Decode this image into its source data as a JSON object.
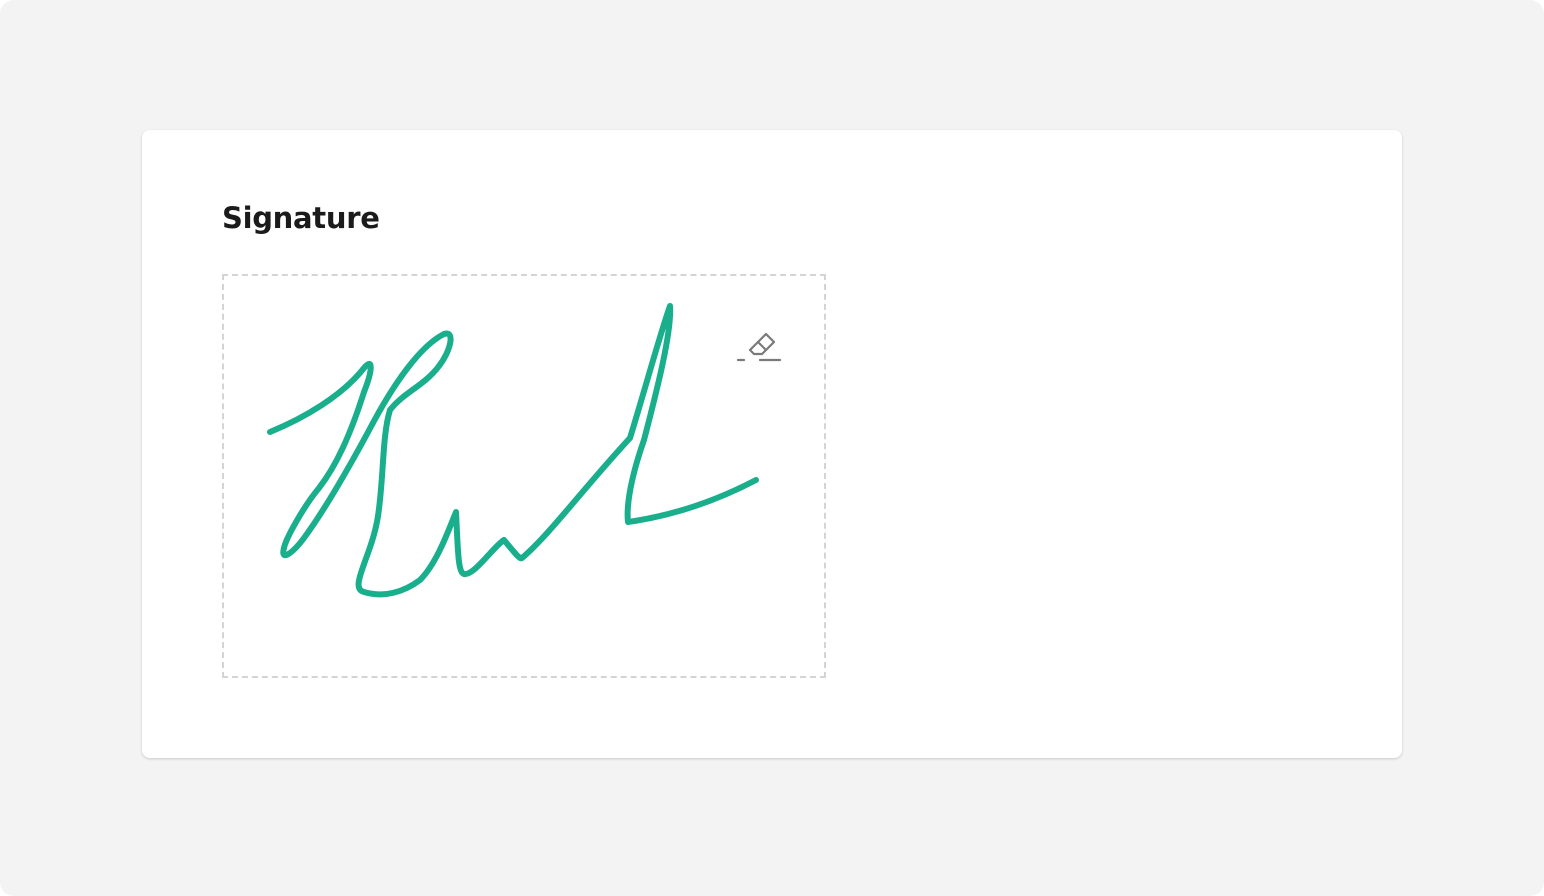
{
  "field": {
    "label": "Signature"
  },
  "signature_pad": {
    "stroke_color": "#1aaf8c",
    "border_color": "#d4d4d4",
    "has_signature": true
  },
  "clear_button": {
    "icon": "eraser-icon",
    "icon_color": "#7a7a7a"
  },
  "colors": {
    "page_background": "#f3f3f3",
    "card_background": "#ffffff",
    "label_text": "#1b1b1b"
  }
}
